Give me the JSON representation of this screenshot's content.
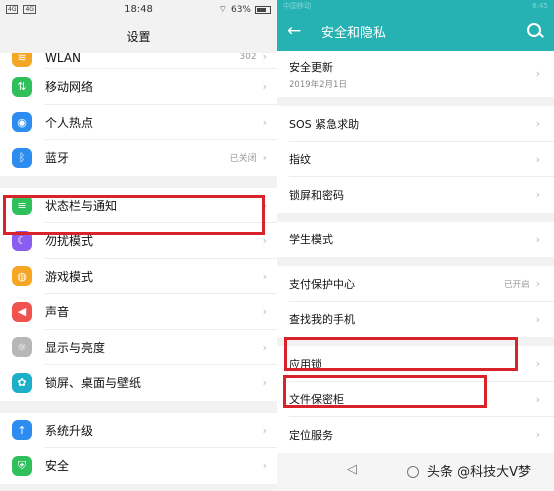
{
  "left": {
    "status": {
      "carrier1": "4G",
      "carrier2": "4G",
      "time": "18:48",
      "battery": "63%"
    },
    "title": "设置",
    "groups": [
      {
        "items": [
          {
            "label": "WLAN",
            "value": "302",
            "icon": "wifi-icon",
            "color": "#f5a623",
            "glyph": "≋",
            "partial": true
          },
          {
            "label": "移动网络",
            "value": "",
            "icon": "network-icon",
            "color": "#2fbf5b",
            "glyph": "⇅"
          },
          {
            "label": "个人热点",
            "value": "",
            "icon": "hotspot-icon",
            "color": "#2d8cf0",
            "glyph": "◉"
          },
          {
            "label": "蓝牙",
            "value": "已关闭",
            "icon": "bluetooth-icon",
            "color": "#2d8cf0",
            "glyph": "ᛒ"
          }
        ]
      },
      {
        "items": [
          {
            "label": "状态栏与通知",
            "value": "",
            "icon": "notification-icon",
            "color": "#2fbf5b",
            "glyph": "≡"
          },
          {
            "label": "勿扰模式",
            "value": "",
            "icon": "moon-icon",
            "color": "#8a5cf0",
            "glyph": "☾"
          },
          {
            "label": "游戏模式",
            "value": "",
            "icon": "gamepad-icon",
            "color": "#f5a623",
            "glyph": "◍"
          },
          {
            "label": "声音",
            "value": "",
            "icon": "sound-icon",
            "color": "#f0524f",
            "glyph": "◀"
          },
          {
            "label": "显示与亮度",
            "value": "",
            "icon": "brightness-icon",
            "color": "#b7b7b7",
            "glyph": "☼"
          },
          {
            "label": "锁屏、桌面与壁纸",
            "value": "",
            "icon": "palette-icon",
            "color": "#1bb0c7",
            "glyph": "✿"
          }
        ]
      },
      {
        "items": [
          {
            "label": "系统升级",
            "value": "",
            "icon": "update-icon",
            "color": "#2d8cf0",
            "glyph": "↑"
          },
          {
            "label": "安全",
            "value": "",
            "icon": "security-icon",
            "color": "#2fbf5b",
            "glyph": "⛨"
          }
        ]
      }
    ]
  },
  "right": {
    "status": {
      "carrier": "中国移动",
      "time": "6:45"
    },
    "title": "安全和隐私",
    "groups": [
      {
        "items": [
          {
            "label": "安全更新",
            "sub": "2019年2月1日",
            "value": ""
          }
        ]
      },
      {
        "items": [
          {
            "label": "SOS 紧急求助",
            "value": ""
          },
          {
            "label": "指纹",
            "value": ""
          },
          {
            "label": "锁屏和密码",
            "value": ""
          }
        ]
      },
      {
        "items": [
          {
            "label": "学生模式",
            "value": ""
          }
        ]
      },
      {
        "items": [
          {
            "label": "支付保护中心",
            "value": "已开启"
          },
          {
            "label": "查找我的手机",
            "value": ""
          }
        ]
      },
      {
        "items": [
          {
            "label": "应用锁",
            "value": ""
          },
          {
            "label": "文件保密柜",
            "value": ""
          },
          {
            "label": "定位服务",
            "value": ""
          }
        ]
      }
    ],
    "watermark": "头条 @科技大V梦"
  },
  "colors": {
    "accent": "#26b2b2",
    "highlight": "#d8232a"
  },
  "chevron": "›"
}
